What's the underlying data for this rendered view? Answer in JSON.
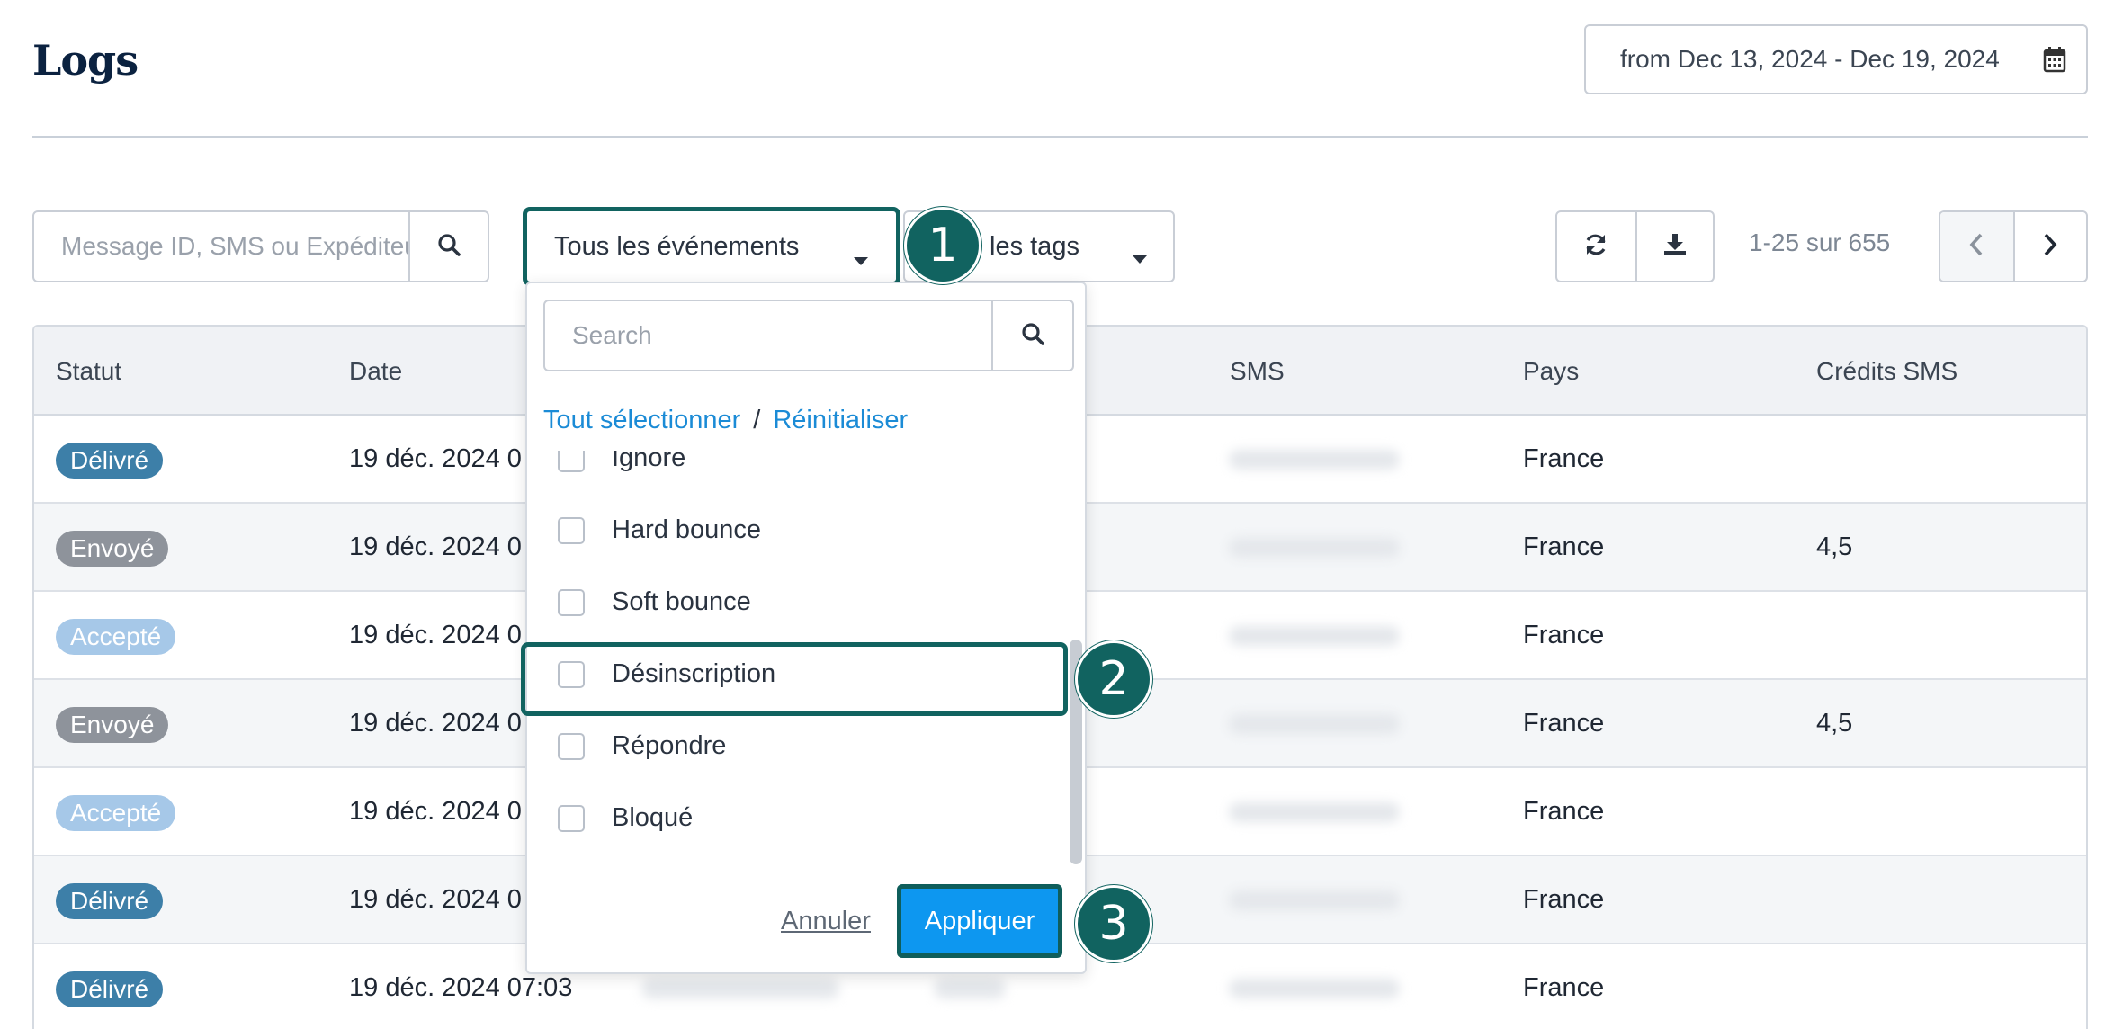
{
  "header": {
    "title": "Logs",
    "date_range": "from Dec 13, 2024  -  Dec 19, 2024"
  },
  "toolbar": {
    "search_placeholder": "Message ID, SMS ou Expéditeur",
    "events_label": "Tous les événements",
    "tags_label": "les tags",
    "pagination": "1-25 sur 655"
  },
  "callouts": [
    "1",
    "2",
    "3"
  ],
  "table": {
    "columns": [
      "Statut",
      "Date",
      "SMS",
      "Pays",
      "Crédits SMS"
    ],
    "rows": [
      {
        "status": "Délivré",
        "status_color": "#3d7fa8",
        "date": "19 déc. 2024 0",
        "country": "France",
        "credits": ""
      },
      {
        "status": "Envoyé",
        "status_color": "#8e939b",
        "date": "19 déc. 2024 0",
        "country": "France",
        "credits": "4,5"
      },
      {
        "status": "Accepté",
        "status_color": "#a6c8e8",
        "date": "19 déc. 2024 0",
        "country": "France",
        "credits": ""
      },
      {
        "status": "Envoyé",
        "status_color": "#8e939b",
        "date": "19 déc. 2024 0",
        "country": "France",
        "credits": "4,5"
      },
      {
        "status": "Accepté",
        "status_color": "#a6c8e8",
        "date": "19 déc. 2024 0",
        "country": "France",
        "credits": ""
      },
      {
        "status": "Délivré",
        "status_color": "#3d7fa8",
        "date": "19 déc. 2024 0",
        "country": "France",
        "credits": ""
      },
      {
        "status": "Délivré",
        "status_color": "#3d7fa8",
        "date": "19 déc. 2024 07:03",
        "country": "France",
        "credits": ""
      }
    ]
  },
  "dropdown": {
    "search_placeholder": "Search",
    "select_all": "Tout sélectionner",
    "separator": "/",
    "reset": "Réinitialiser",
    "options": [
      "Ignore",
      "Hard bounce",
      "Soft bounce",
      "Désinscription",
      "Répondre",
      "Bloqué"
    ],
    "cancel": "Annuler",
    "apply": "Appliquer"
  },
  "colors": {
    "accent": "#116360",
    "primary": "#0d97f0",
    "link": "#1b8bd6"
  }
}
